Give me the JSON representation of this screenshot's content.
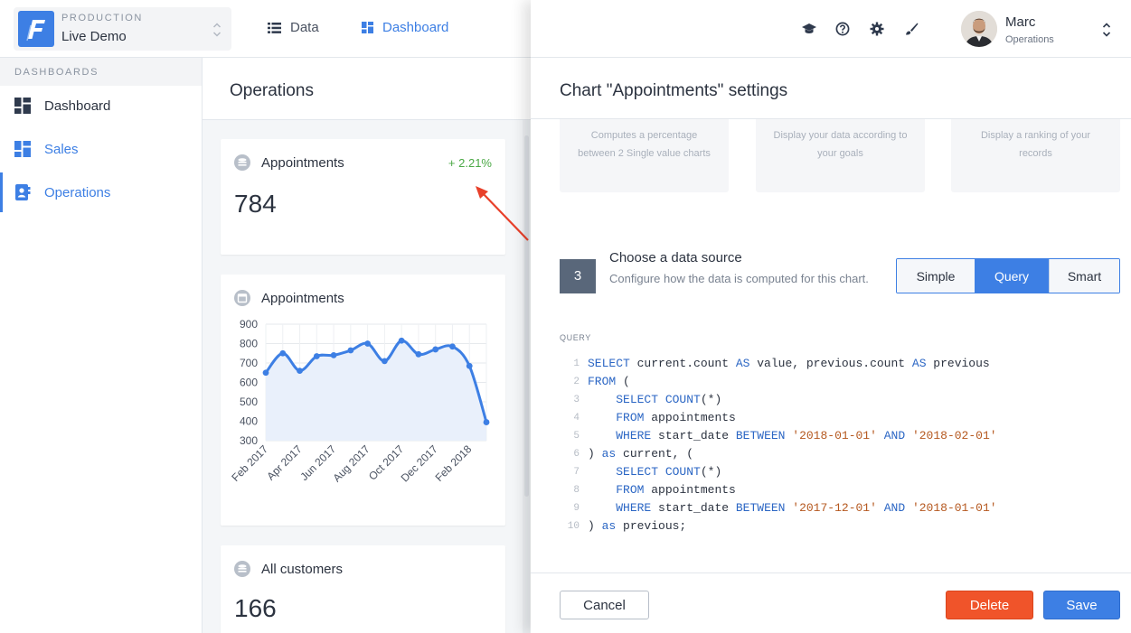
{
  "app": {
    "env_label": "PRODUCTION",
    "env_name": "Live Demo",
    "nav": [
      {
        "label": "Data",
        "icon": "list-icon",
        "active": false
      },
      {
        "label": "Dashboard",
        "icon": "dashboard-grid-icon",
        "active": true
      }
    ]
  },
  "sidebar": {
    "section_label": "DASHBOARDS",
    "items": [
      {
        "label": "Dashboard",
        "icon": "dashboard-grid-icon"
      },
      {
        "label": "Sales",
        "icon": "dashboard-grid-icon"
      },
      {
        "label": "Operations",
        "icon": "contact-book-icon",
        "active": true
      }
    ]
  },
  "main": {
    "title": "Operations",
    "cards": [
      {
        "title": "Appointments",
        "delta": "+ 2.21%",
        "value": "784",
        "icon": "database-icon"
      },
      {
        "title": "Appointments",
        "icon": "calendar-icon"
      },
      {
        "title": "All customers",
        "value": "166",
        "icon": "database-icon"
      }
    ]
  },
  "chart_data": {
    "type": "area",
    "title": "Appointments",
    "x": [
      "Feb 2017",
      "Mar 2017",
      "Apr 2017",
      "May 2017",
      "Jun 2017",
      "Jul 2017",
      "Aug 2017",
      "Sep 2017",
      "Oct 2017",
      "Nov 2017",
      "Dec 2017",
      "Jan 2018",
      "Feb 2018",
      "Mar 2018"
    ],
    "tick_labels": [
      "Feb 2017",
      "Apr 2017",
      "Jun 2017",
      "Aug 2017",
      "Oct 2017",
      "Dec 2017",
      "Feb 2018"
    ],
    "values": [
      650,
      750,
      660,
      735,
      740,
      765,
      800,
      710,
      815,
      745,
      770,
      785,
      685,
      395
    ],
    "ylim": [
      300,
      900
    ],
    "yticks": [
      300,
      400,
      500,
      600,
      700,
      800,
      900
    ],
    "grid": true,
    "color": "#3d7fe4",
    "fill": "#e9f0fb"
  },
  "panel": {
    "title": "Chart \"Appointments\" settings",
    "user": {
      "name": "Marc",
      "role": "Operations"
    },
    "type_cards": [
      {
        "desc": "Computes a percentage between 2 Single value charts"
      },
      {
        "desc": "Display your data according to your goals"
      },
      {
        "desc": "Display a ranking of your records"
      }
    ],
    "step": {
      "number": "3",
      "title": "Choose a data source",
      "desc": "Configure how the data is computed for this chart."
    },
    "source_options": [
      {
        "label": "Simple",
        "active": false
      },
      {
        "label": "Query",
        "active": true
      },
      {
        "label": "Smart",
        "active": false
      }
    ],
    "query_label": "QUERY",
    "query_lines": [
      {
        "n": "1",
        "parts": [
          {
            "t": "kw",
            "v": "SELECT"
          },
          {
            "t": "tx",
            "v": " current.count "
          },
          {
            "t": "kw",
            "v": "AS"
          },
          {
            "t": "tx",
            "v": " value, previous.count "
          },
          {
            "t": "kw",
            "v": "AS"
          },
          {
            "t": "tx",
            "v": " previous"
          }
        ]
      },
      {
        "n": "2",
        "parts": [
          {
            "t": "kw",
            "v": "FROM"
          },
          {
            "t": "tx",
            "v": " ("
          }
        ]
      },
      {
        "n": "3",
        "parts": [
          {
            "t": "tx",
            "v": "    "
          },
          {
            "t": "kw",
            "v": "SELECT COUNT"
          },
          {
            "t": "tx",
            "v": "(*)"
          }
        ]
      },
      {
        "n": "4",
        "parts": [
          {
            "t": "tx",
            "v": "    "
          },
          {
            "t": "kw",
            "v": "FROM"
          },
          {
            "t": "tx",
            "v": " appointments"
          }
        ]
      },
      {
        "n": "5",
        "parts": [
          {
            "t": "tx",
            "v": "    "
          },
          {
            "t": "kw",
            "v": "WHERE"
          },
          {
            "t": "tx",
            "v": " start_date "
          },
          {
            "t": "kw",
            "v": "BETWEEN"
          },
          {
            "t": "tx",
            "v": " "
          },
          {
            "t": "str",
            "v": "'2018-01-01'"
          },
          {
            "t": "tx",
            "v": " "
          },
          {
            "t": "kw",
            "v": "AND"
          },
          {
            "t": "tx",
            "v": " "
          },
          {
            "t": "str",
            "v": "'2018-02-01'"
          }
        ]
      },
      {
        "n": "6",
        "parts": [
          {
            "t": "tx",
            "v": ") "
          },
          {
            "t": "kw",
            "v": "as"
          },
          {
            "t": "tx",
            "v": " current, ("
          }
        ]
      },
      {
        "n": "7",
        "parts": [
          {
            "t": "tx",
            "v": "    "
          },
          {
            "t": "kw",
            "v": "SELECT COUNT"
          },
          {
            "t": "tx",
            "v": "(*)"
          }
        ]
      },
      {
        "n": "8",
        "parts": [
          {
            "t": "tx",
            "v": "    "
          },
          {
            "t": "kw",
            "v": "FROM"
          },
          {
            "t": "tx",
            "v": " appointments"
          }
        ]
      },
      {
        "n": "9",
        "parts": [
          {
            "t": "tx",
            "v": "    "
          },
          {
            "t": "kw",
            "v": "WHERE"
          },
          {
            "t": "tx",
            "v": " start_date "
          },
          {
            "t": "kw",
            "v": "BETWEEN"
          },
          {
            "t": "tx",
            "v": " "
          },
          {
            "t": "str",
            "v": "'2017-12-01'"
          },
          {
            "t": "tx",
            "v": " "
          },
          {
            "t": "kw",
            "v": "AND"
          },
          {
            "t": "tx",
            "v": " "
          },
          {
            "t": "str",
            "v": "'2018-01-01'"
          }
        ]
      },
      {
        "n": "10",
        "parts": [
          {
            "t": "tx",
            "v": ") "
          },
          {
            "t": "kw",
            "v": "as"
          },
          {
            "t": "tx",
            "v": " previous;"
          }
        ]
      }
    ],
    "buttons": {
      "cancel": "Cancel",
      "delete": "Delete",
      "save": "Save"
    }
  },
  "colors": {
    "accent": "#3d7fe4",
    "danger": "#f0542a",
    "positive": "#4aa845",
    "annotation_arrow": "#e8402a"
  }
}
